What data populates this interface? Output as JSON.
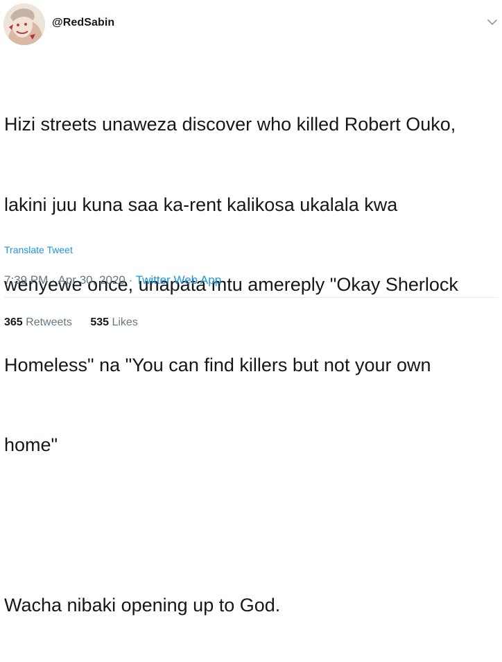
{
  "user": {
    "handle": "@RedSabin"
  },
  "tweet": {
    "lines": [
      "Hizi streets unaweza discover who killed Robert Ouko,",
      "lakini juu kuna saa ka-rent kalikosa ukalala kwa",
      "wenyewe once, unapata mtu amereply \"Okay Sherlock",
      "Homeless\" na \"You can find killers but not your own",
      "home\"",
      "",
      "Wacha nibaki opening up to God."
    ],
    "translate_label": "Translate Tweet",
    "time": "7:39 PM",
    "separator": "·",
    "date": "Apr 30, 2020",
    "source": "Twitter Web App"
  },
  "stats": {
    "retweets_count": "365",
    "retweets_label": "Retweets",
    "likes_count": "535",
    "likes_label": "Likes"
  },
  "colors": {
    "link": "#1b95e0",
    "text": "#14171a",
    "muted": "#657786",
    "divider": "#e6ecf0"
  },
  "icons": {
    "avatar": "avatar",
    "caret": "chevron-down-icon"
  }
}
